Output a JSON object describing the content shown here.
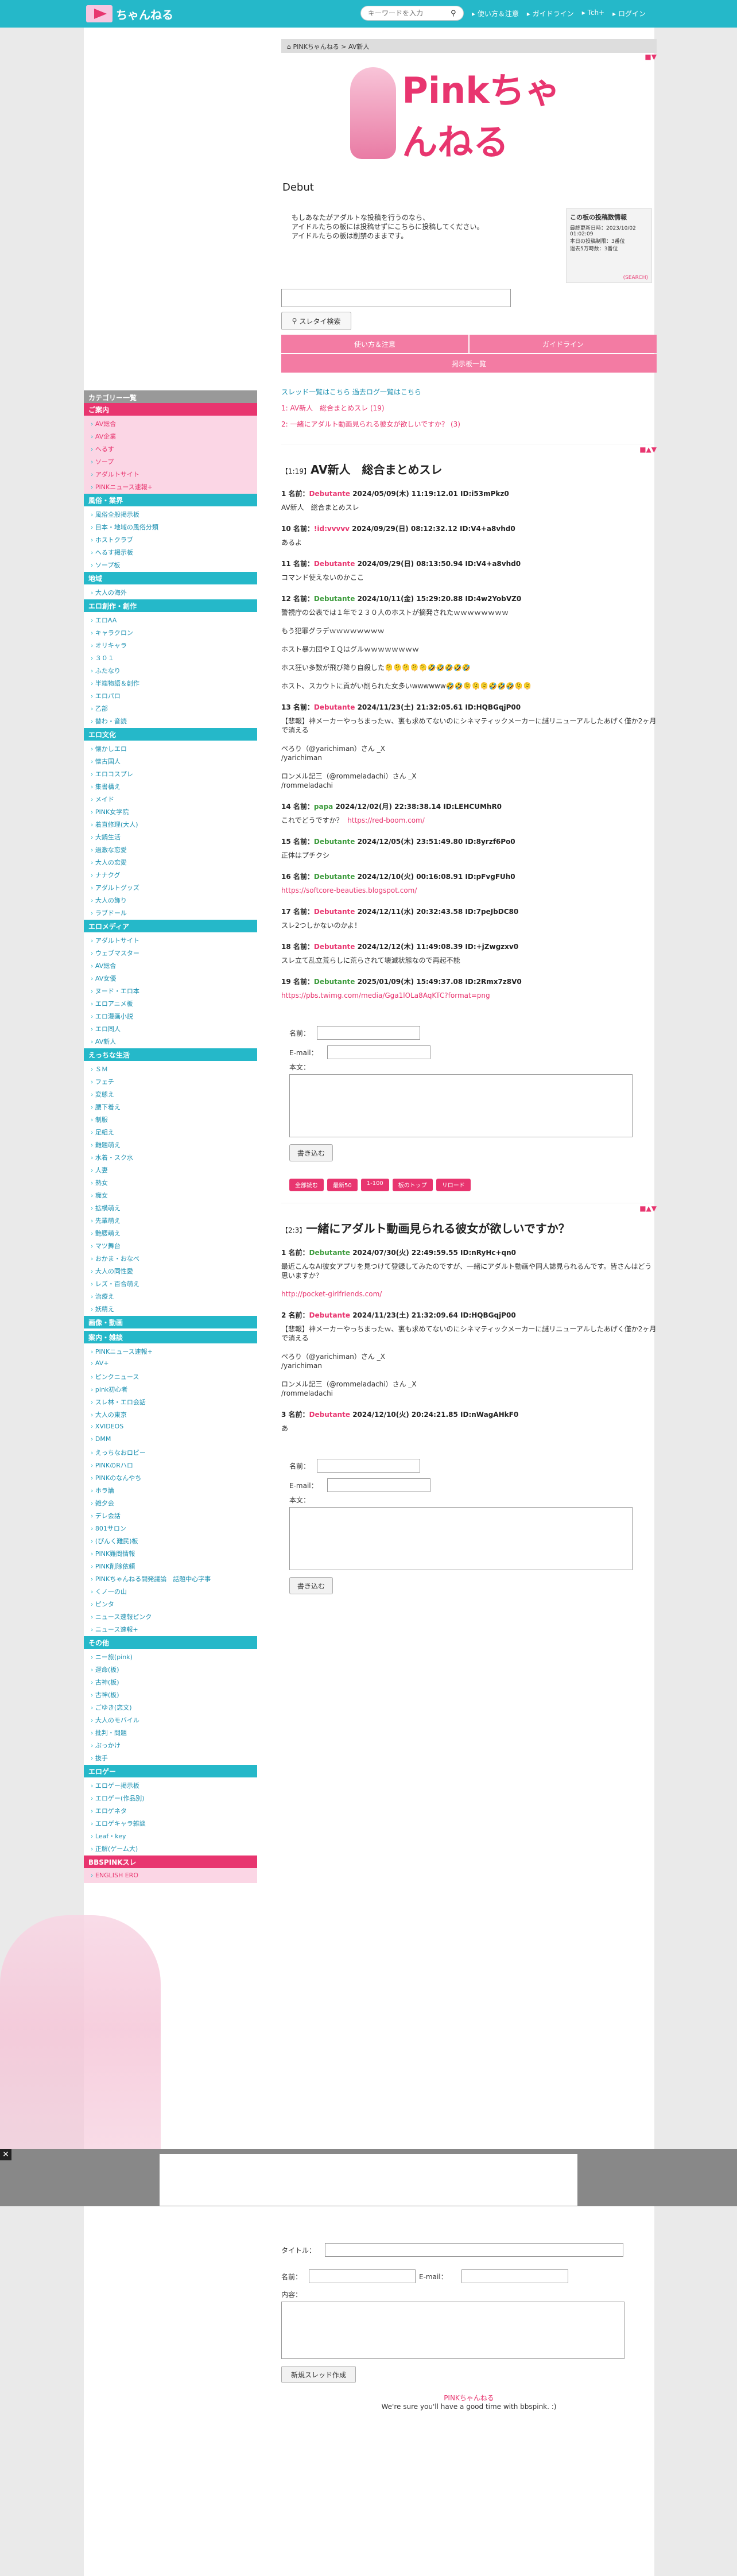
{
  "header": {
    "logo": "ちゃんねる",
    "search_placeholder": "キーワードを入力",
    "nav": [
      "使い方＆注意",
      "ガイドライン",
      "Tch+",
      "ログイン"
    ]
  },
  "sidebar": {
    "category_title": "カテゴリー一覧",
    "sections": [
      {
        "title": "ご案内",
        "pink": true,
        "items": [
          "AV総合",
          "AV企業",
          "へるす",
          "ソープ",
          "アダルトサイト",
          "PINKニュース速報+"
        ]
      },
      {
        "title": "風俗・業界",
        "items": [
          "風俗全般掲示板",
          "日本・地域の風俗分類",
          "ホストクラブ",
          "へるす掲示板",
          "ソープ板"
        ]
      },
      {
        "title": "地域",
        "items": [
          "大人の海外"
        ]
      },
      {
        "title": "エロ創作・創作",
        "items": [
          "エロAA",
          "キャラクロン",
          "オリキャラ",
          "３０１",
          "ふたなり",
          "半端物語＆創作",
          "エロパロ",
          "乙部",
          "替わ・音読"
        ]
      },
      {
        "title": "エロ文化",
        "items": [
          "懐かしエロ",
          "懐古国人",
          "エロコスプレ",
          "集書構え",
          "メイド",
          "PINK女学院",
          "着直修理(大人)",
          "大鍋生活",
          "過激な恋愛",
          "大人の恋愛",
          "ナナクグ",
          "アダルトグッズ",
          "大人の飾り",
          "ラブドール"
        ]
      },
      {
        "title": "エロメディア",
        "items": [
          "アダルトサイト",
          "ウェブマスター",
          "AV総合",
          "AV女優",
          "ヌード・エロ本",
          "エロアニメ板",
          "エロ漫画小説",
          "エロ同人",
          "AV新人"
        ]
      },
      {
        "title": "えっちな生活",
        "items": [
          "ＳＭ",
          "フェチ",
          "変態え",
          "腰下着え",
          "制服",
          "足組え",
          "難題萌え",
          "水着・スク水",
          "人妻",
          "熟女",
          "痴女",
          "拡横萌え",
          "先輩萌え",
          "艶腰萌え",
          "マツ舞台",
          "おかま・おなべ",
          "大人の同性愛",
          "レズ・百合萌え",
          "治療え",
          "妖精え"
        ]
      },
      {
        "title": "画像・動画",
        "items": []
      },
      {
        "title": "案内・雑談",
        "items": [
          "PINKニュース速報+",
          "AV+",
          "ピンクニュース",
          "pink初心者",
          "スレ林・エロ会話",
          "大人の東京",
          "XVIDEOS",
          "DMM",
          "えっちなおロビー",
          "PINKのRハロ",
          "PINKのなんやち",
          "ホラ論",
          "雑夕会",
          "デレ会話",
          "801サロン",
          "(ぴんく難民)板",
          "PINK難問情報",
          "PINK削除依頼",
          "PINKちゃんねる開発議論　話題中心字事",
          "くノ一の山",
          "ピンタ",
          "ニュース速報ピンク",
          "ニュース速報+"
        ]
      },
      {
        "title": "その他",
        "items": [
          "ニー旅(pink)",
          "運命(板)",
          "古神(板)",
          "古神(板)",
          "ごゆき(恋文)",
          "大人のモバイル",
          "批判・問題",
          "ぷっかけ",
          "抜手"
        ]
      },
      {
        "title": "エロゲー",
        "items": [
          "エロゲー掲示板",
          "エロゲー(作品別)",
          "エロゲネタ",
          "エロゲキャラ雑談",
          "Leaf・key",
          "正解(ゲーム大)"
        ]
      },
      {
        "title": "BBSPINKスレ",
        "pink": true,
        "items": [
          "ENGLISH ERO"
        ]
      }
    ]
  },
  "main": {
    "breadcrumb": "PINKちゃんねる > AV新人",
    "banner_text": "Pinkちゃんねる",
    "board_title": "Debut",
    "rules": "もしあなたがアダルトな投稿を行うのなら、\nアイドルたちの板には投稿せずにこちらに投稿してください。\nアイドルたちの板は削禁のままです。",
    "rule_box": {
      "title": "この板の投稿数情報",
      "lines": [
        "最終更新日時：2023/10/02 01:02:09",
        "本日の投稿制限：3番位",
        "過去5万時数：3番位"
      ],
      "footer": "(SEARCH)"
    },
    "search_button": "スレタイ検索",
    "buttons": [
      "使い方＆注意",
      "ガイドライン",
      "掲示板一覧"
    ],
    "thread_list_head": "スレッド一覧はこちら 過去ログ一覧はこちら",
    "thread_links": [
      "1: AV新人　総合まとめスレ (19)",
      "2: 一緒にアダルト動画見られる彼女が欲しいですか？ (3)"
    ],
    "threads": [
      {
        "num": "【1:19】",
        "title": "AV新人　総合まとめスレ",
        "posts": [
          {
            "head": "1 名前：",
            "name": "Debutante",
            "date": "2024/05/09(木) 11:19:12.01 ID:i53mPkz0",
            "green": false,
            "body": "AV新人　総合まとめスレ"
          },
          {
            "head": "10 名前：",
            "name": "!id:vvvvv",
            "date": "2024/09/29(日) 08:12:32.12 ID:V4+a8vhd0",
            "green": false,
            "body": "あるよ"
          },
          {
            "head": "11 名前：",
            "name": "Debutante",
            "date": "2024/09/29(日) 08:13:50.94 ID:V4+a8vhd0",
            "green": false,
            "body": "コマンド使えないのかここ"
          },
          {
            "head": "12 名前：",
            "name": "Debutante",
            "date": "2024/10/11(金) 15:29:20.88 ID:4w2YobVZ0",
            "green": true,
            "body": "警視庁の公表では１年で２３０人のホストが摘発されたｗｗｗｗｗｗｗｗ\n\nもう犯罪グラデｗｗｗｗｗｗｗｗ\n\nホスト暴力団やＩＱはグルｗｗｗｗｗｗｗｗ\n\nホス狂い多数が飛び降り自殺した🫠🫠🫠🫠🫠🤣🤣🤣🤣🤣\n\nホスト、スカウトに貢がい削られた女多いwwwwww🤣🤣🫠🫠🫠🤣🤣🤣🫠🫠"
          },
          {
            "head": "13 名前：",
            "name": "Debutante",
            "date": "2024/11/23(土) 21:32:05.61 ID:HQBGqjP00",
            "green": false,
            "body": "【悲報】神メーカーやっちまったｗ、裏も求めてないのにシネマティックメーカーに謎リニューアルしたあげく僅か2ヶ月で消える\n\nぺろり（@yarichiman）さん _X\n/yarichiman\n\nロンメル記三（@rommeladachi）さん _X\n/rommeladachi"
          },
          {
            "head": "14 名前：",
            "name": "papa",
            "date": "2024/12/02(月) 22:38:38.14 ID:LEHCUMhR0",
            "green": true,
            "body": "これでどうですか？  ",
            "url": "https://red-boom.com/"
          },
          {
            "head": "15 名前：",
            "name": "Debutante",
            "date": "2024/12/05(木) 23:51:49.80 ID:8yrzf6Po0",
            "green": true,
            "body": "正体はプチクシ"
          },
          {
            "head": "16 名前：",
            "name": "Debutante",
            "date": "2024/12/10(火) 00:16:08.91 ID:pFvgFUh0",
            "green": true,
            "body": "",
            "url": "https://softcore-beauties.blogspot.com/"
          },
          {
            "head": "17 名前：",
            "name": "Debutante",
            "date": "2024/12/11(水) 20:32:43.58 ID:7peJbDC80",
            "green": false,
            "body": "スレ2つしかないのかよ！"
          },
          {
            "head": "18 名前：",
            "name": "Debutante",
            "date": "2024/12/12(木) 11:49:08.39 ID:+jZwgzxv0",
            "green": false,
            "body": "スレ立て乱立荒らしに荒らされて壊滅状態なので再起不能"
          },
          {
            "head": "19 名前：",
            "name": "Debutante",
            "date": "2025/01/09(木) 15:49:37.08 ID:2Rmx7z8V0",
            "green": true,
            "body": "",
            "url": "https://pbs.twimg.com/media/Gga1lOLa8AqKTC?format=png"
          }
        ]
      },
      {
        "num": "【2:3】",
        "title": "一緒にアダルト動画見られる彼女が欲しいですか？",
        "posts": [
          {
            "head": "1 名前：",
            "name": "Debutante",
            "date": "2024/07/30(火) 22:49:59.55 ID:nRyHc+qn0",
            "green": true,
            "body": "最近こんなAI彼女アプリを見つけて登録してみたのですが、一緒にアダルト動画や同人誌見られるんです。皆さんはどう思いますか？\n\n",
            "url": "http://pocket-girlfriends.com/"
          },
          {
            "head": "2 名前：",
            "name": "Debutante",
            "date": "2024/11/23(土) 21:32:09.64 ID:HQBGqjP00",
            "green": false,
            "body": "【悲報】神メーカーやっちまったｗ、裏も求めてないのにシネマティックメーカーに謎リニューアルしたあげく僅か2ヶ月で消える\n\nぺろり（@yarichiman）さん _X\n/yarichiman\n\nロンメル記三（@rommeladachi）さん _X\n/rommeladachi"
          },
          {
            "head": "3 名前：",
            "name": "Debutante",
            "date": "2024/12/10(火) 20:24:21.85 ID:nWagAHkF0",
            "green": false,
            "body": "あ"
          }
        ]
      }
    ],
    "form": {
      "name": "名前：",
      "email": "E-mail：",
      "body": "本文：",
      "submit": "書き込む"
    },
    "nav_buttons": [
      "全部読む",
      "最新50",
      "1-100",
      "板のトップ",
      "リロード"
    ],
    "new_thread": {
      "title": "タイトル：",
      "name": "名前：",
      "email": "E-mail：",
      "body": "内容：",
      "submit": "新規スレッド作成"
    },
    "footer": {
      "brand": "PINKちゃんねる",
      "tagline": "We're sure you'll have a good time with bbspink. :)"
    }
  }
}
